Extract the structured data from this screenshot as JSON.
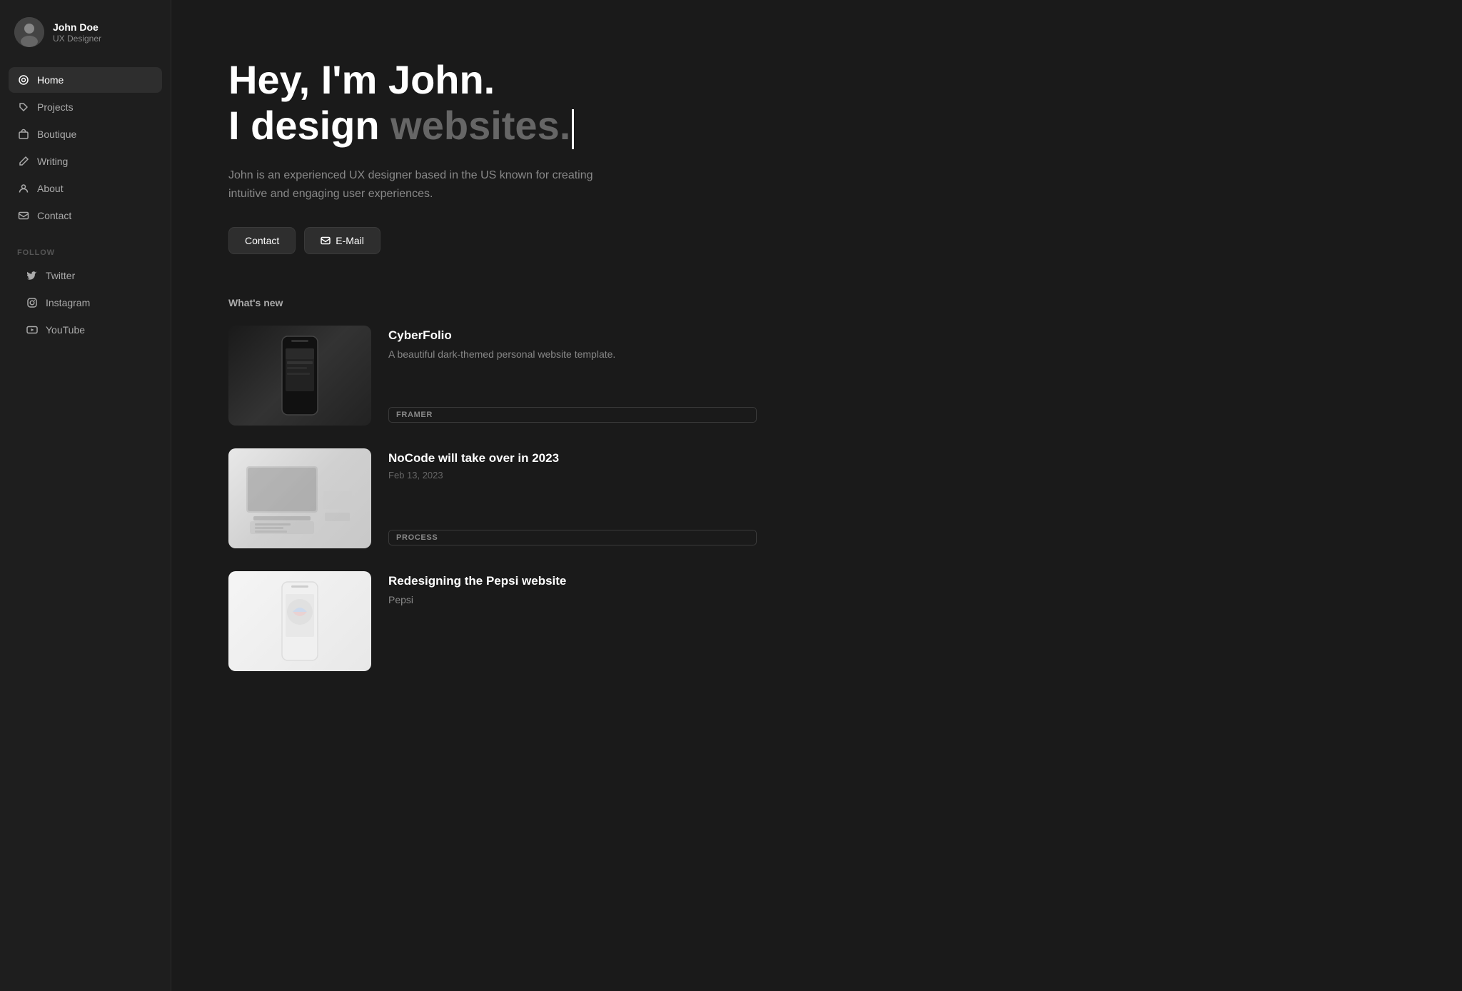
{
  "sidebar": {
    "profile": {
      "name": "John Doe",
      "role": "UX Designer"
    },
    "nav": [
      {
        "id": "home",
        "label": "Home",
        "icon": "home-icon",
        "active": true
      },
      {
        "id": "projects",
        "label": "Projects",
        "icon": "tag-icon",
        "active": false
      },
      {
        "id": "boutique",
        "label": "Boutique",
        "icon": "bag-icon",
        "active": false
      },
      {
        "id": "writing",
        "label": "Writing",
        "icon": "edit-icon",
        "active": false
      },
      {
        "id": "about",
        "label": "About",
        "icon": "user-icon",
        "active": false
      },
      {
        "id": "contact",
        "label": "Contact",
        "icon": "mail-icon",
        "active": false
      }
    ],
    "follow_label": "FOLLOW",
    "social": [
      {
        "id": "twitter",
        "label": "Twitter",
        "icon": "twitter-icon"
      },
      {
        "id": "instagram",
        "label": "Instagram",
        "icon": "instagram-icon"
      },
      {
        "id": "youtube",
        "label": "YouTube",
        "icon": "youtube-icon"
      }
    ]
  },
  "hero": {
    "line1": "Hey, I'm John.",
    "line2_prefix": "I design ",
    "line2_highlight": "websites.",
    "description": "John is an experienced UX designer based in the US known for creating intuitive and engaging user experiences.",
    "btn_contact": "Contact",
    "btn_email": "E-Mail"
  },
  "whats_new": {
    "label": "What's new",
    "items": [
      {
        "id": "cyberfolio",
        "title": "CyberFolio",
        "description": "A beautiful dark-themed personal website template.",
        "tag": "FRAMER",
        "image_type": "dark"
      },
      {
        "id": "nocode",
        "title": "NoCode will take over in 2023",
        "date": "Feb 13, 2023",
        "tag": "PROCESS",
        "image_type": "light"
      },
      {
        "id": "pepsi",
        "title": "Redesigning the Pepsi website",
        "description": "Pepsi",
        "image_type": "white"
      }
    ]
  }
}
